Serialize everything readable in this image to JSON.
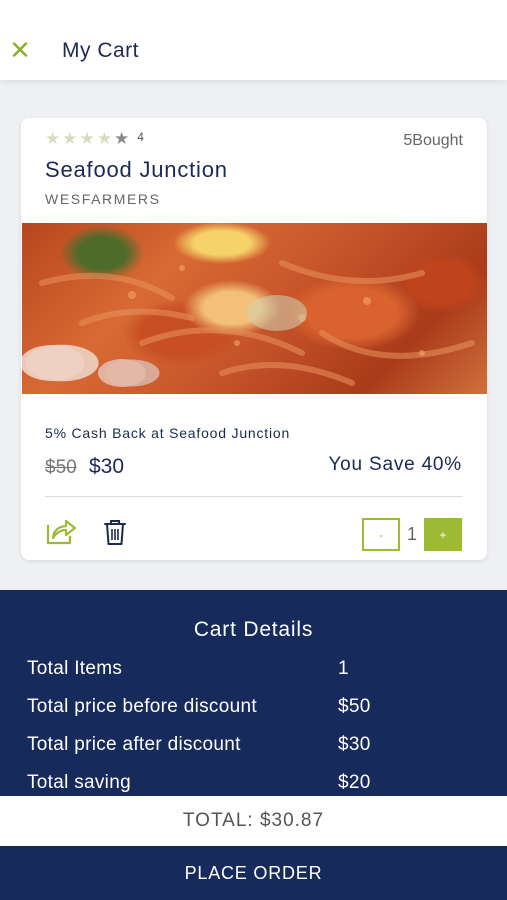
{
  "header": {
    "close_icon": "✕",
    "title": "My Cart"
  },
  "item": {
    "rating_value": 4,
    "rating_max": 5,
    "rating_count": "4",
    "bought": "5Bought",
    "name": "Seafood Junction",
    "brand": "WESFARMERS",
    "cashback": "5% Cash Back at Seafood Junction",
    "old_price": "$50",
    "new_price": "$30",
    "save": "You Save 40%",
    "quantity": "1",
    "minus_label": "-",
    "plus_label": "+",
    "icons": {
      "share": "share-icon",
      "delete": "trash-icon",
      "photo": "seafood-photo"
    }
  },
  "cart_details": {
    "title": "Cart Details",
    "rows": [
      {
        "label": "Total Items",
        "value": "1"
      },
      {
        "label": "Total price before discount",
        "value": "$50"
      },
      {
        "label": "Total price after discount",
        "value": "$30"
      },
      {
        "label": "Total saving",
        "value": "$20"
      }
    ]
  },
  "total": "TOTAL: $30.87",
  "place_order": "PLACE ORDER",
  "colors": {
    "navy": "#172a5c",
    "accent_green": "#9dba34",
    "star_filled": "#d7dcc0",
    "star_empty": "#8a8a8a"
  }
}
